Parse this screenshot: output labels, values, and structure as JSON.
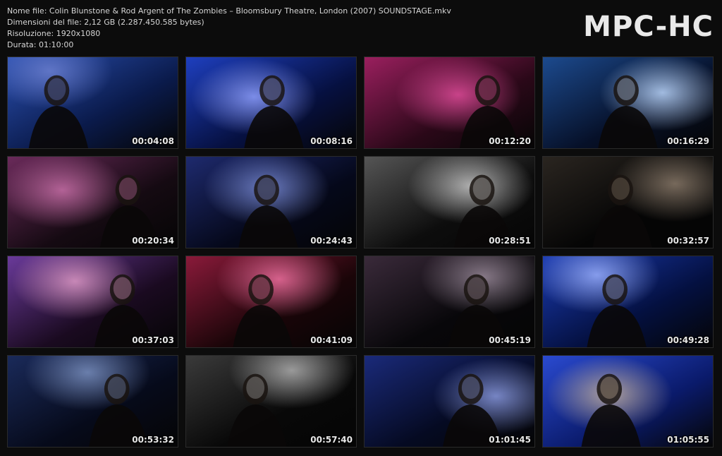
{
  "info": {
    "file_name": "Nome file: Colin Blunstone & Rod Argent of The Zombies – Bloomsbury Theatre, London (2007) SOUNDSTAGE.mkv",
    "file_size": "Dimensioni del file: 2,12 GB (2.287.450.585 bytes)",
    "resolution": "Risoluzione: 1920x1080",
    "duration": "Durata: 01:10:00"
  },
  "brand": "MPC-HC",
  "thumbnails": [
    {
      "time": "00:04:08",
      "scene": "singer-closeup",
      "colors": [
        "#0a1a4a",
        "#2a4fb0",
        "#6b7fd0"
      ]
    },
    {
      "time": "00:08:16",
      "scene": "singer-mic",
      "colors": [
        "#061040",
        "#1e3fbf",
        "#8fa0ff"
      ]
    },
    {
      "time": "00:12:20",
      "scene": "stage-magenta",
      "colors": [
        "#2a0818",
        "#9a1f5e",
        "#e04c9a"
      ]
    },
    {
      "time": "00:16:29",
      "scene": "drummer-blue",
      "colors": [
        "#061028",
        "#1c4a8e",
        "#bcd8ff"
      ]
    },
    {
      "time": "00:20:34",
      "scene": "band-stage",
      "colors": [
        "#150a12",
        "#6a2a5a",
        "#c86fa8"
      ]
    },
    {
      "time": "00:24:43",
      "scene": "keyboard-player",
      "colors": [
        "#05081a",
        "#1e2a6e",
        "#7b8dd8"
      ]
    },
    {
      "time": "00:28:51",
      "scene": "grayscale-piano",
      "colors": [
        "#0d0d0d",
        "#555555",
        "#c8c8c8"
      ]
    },
    {
      "time": "00:32:57",
      "scene": "singer-dark",
      "colors": [
        "#050505",
        "#2a2520",
        "#8a7a6a"
      ]
    },
    {
      "time": "00:37:03",
      "scene": "guitar-purple",
      "colors": [
        "#1a0a20",
        "#6a3a9a",
        "#e09ac8"
      ]
    },
    {
      "time": "00:41:09",
      "scene": "drums-red",
      "colors": [
        "#1a0508",
        "#8a1a3a",
        "#f070a0"
      ]
    },
    {
      "time": "00:45:19",
      "scene": "drums-dim",
      "colors": [
        "#08070a",
        "#3a2a3a",
        "#9a8a9a"
      ]
    },
    {
      "time": "00:49:28",
      "scene": "duo-blue",
      "colors": [
        "#041040",
        "#1a3ab0",
        "#9ab0ff"
      ]
    },
    {
      "time": "00:53:32",
      "scene": "band-wide",
      "colors": [
        "#060a1a",
        "#1a2a5a",
        "#7a90c0"
      ]
    },
    {
      "time": "00:57:40",
      "scene": "keys-grayscale",
      "colors": [
        "#080808",
        "#3a3a3a",
        "#b0b0b0"
      ]
    },
    {
      "time": "01:01:45",
      "scene": "drummer-blue-2",
      "colors": [
        "#050a22",
        "#1a2a7a",
        "#8a9ae0"
      ]
    },
    {
      "time": "01:05:55",
      "scene": "singer-blue-bg",
      "colors": [
        "#0a1a6a",
        "#2a4ad0",
        "#c8b4a0"
      ]
    }
  ]
}
